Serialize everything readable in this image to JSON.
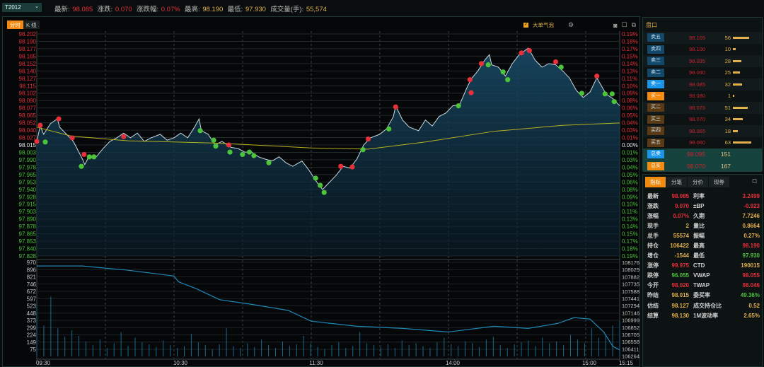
{
  "symbol": "T2012",
  "quote": [
    {
      "label": "最新:",
      "value": "98.085",
      "color": "red"
    },
    {
      "label": "涨跌:",
      "value": "0.070",
      "color": "red"
    },
    {
      "label": "涨跌幅:",
      "value": "0.07%",
      "color": "red"
    },
    {
      "label": "最高:",
      "value": "98.190",
      "color": "gold"
    },
    {
      "label": "最低:",
      "value": "97.930",
      "color": "gold"
    },
    {
      "label": "成交量(手):",
      "value": "55,574",
      "color": "gold"
    }
  ],
  "chart_tabs": [
    "分时",
    "K 线"
  ],
  "chart_options": {
    "bubble_label": "大单气泡",
    "bubble_checked": true
  },
  "colors": {
    "up": "#e8303a",
    "down": "#4cc43a",
    "neutral": "#e8e8e8",
    "avg": "#b8b020",
    "line": "#c8d8e0",
    "oi": "#1e8ab8",
    "vol": "#1a6a90"
  },
  "chart_data": {
    "type": "line",
    "price_ticks": [
      "98.202",
      "98.190",
      "98.177",
      "98.165",
      "98.152",
      "98.140",
      "98.127",
      "98.115",
      "98.102",
      "98.090",
      "98.077",
      "98.065",
      "98.052",
      "98.040",
      "98.027",
      "98.015",
      "98.003",
      "97.990",
      "97.978",
      "97.965",
      "97.953",
      "97.940",
      "97.928",
      "97.915",
      "97.903",
      "97.890",
      "97.878",
      "97.865",
      "97.853",
      "97.840",
      "97.828"
    ],
    "pct_ticks": [
      "0.19%",
      "0.18%",
      "0.17%",
      "0.15%",
      "0.14%",
      "0.13%",
      "0.11%",
      "0.10%",
      "0.09%",
      "0.08%",
      "0.06%",
      "0.05%",
      "0.04%",
      "0.03%",
      "0.01%",
      "0.00%",
      "0.01%",
      "0.03%",
      "0.04%",
      "0.05%",
      "0.06%",
      "0.08%",
      "0.09%",
      "0.10%",
      "0.11%",
      "0.13%",
      "0.14%",
      "0.15%",
      "0.17%",
      "0.18%",
      "0.19%"
    ],
    "prev_settle": 98.015,
    "ylim": [
      97.828,
      98.202
    ],
    "vol_ticks": [
      "970",
      "896",
      "821",
      "746",
      "672",
      "597",
      "523",
      "448",
      "373",
      "299",
      "224",
      "149",
      "75"
    ],
    "oi_ticks": [
      "108176",
      "108029",
      "107882",
      "107735",
      "107588",
      "107441",
      "107294",
      "107146",
      "106999",
      "106852",
      "106705",
      "106558",
      "106411",
      "106264"
    ],
    "vol_ylim": [
      0,
      1007
    ],
    "oi_ylim": [
      106264,
      108176
    ],
    "time_ticks": [
      "09:30",
      "10:30",
      "11:30",
      "14:00",
      "15:00",
      "15:15"
    ],
    "total_minutes": 255,
    "price": [
      [
        0,
        98.021
      ],
      [
        1.5,
        98.047
      ],
      [
        3,
        98.033
      ],
      [
        6,
        98.051
      ],
      [
        9,
        98.059
      ],
      [
        10,
        98.045
      ],
      [
        13,
        98.033
      ],
      [
        16,
        98.021
      ],
      [
        20,
        97.991
      ],
      [
        21,
        97.982
      ],
      [
        23,
        97.997
      ],
      [
        26,
        97.995
      ],
      [
        29,
        98.009
      ],
      [
        32,
        98.021
      ],
      [
        35,
        98.027
      ],
      [
        38,
        98.035
      ],
      [
        41,
        98.027
      ],
      [
        44,
        98.035
      ],
      [
        47,
        98.021
      ],
      [
        50,
        98.027
      ],
      [
        54,
        98.033
      ],
      [
        57,
        98.023
      ],
      [
        60,
        98.027
      ],
      [
        63,
        98.035
      ],
      [
        66,
        98.027
      ],
      [
        69,
        98.045
      ],
      [
        71,
        98.059
      ],
      [
        72,
        98.039
      ],
      [
        75,
        98.033
      ],
      [
        78,
        98.015
      ],
      [
        81,
        98.021
      ],
      [
        85,
        98.011
      ],
      [
        88,
        98.009
      ],
      [
        91,
        98.003
      ],
      [
        94,
        98.003
      ],
      [
        97,
        97.995
      ],
      [
        100,
        97.991
      ],
      [
        103,
        97.988
      ],
      [
        106,
        97.995
      ],
      [
        109,
        97.985
      ],
      [
        112,
        97.979
      ],
      [
        116,
        97.988
      ],
      [
        119,
        97.973
      ],
      [
        122,
        97.955
      ],
      [
        125,
        97.94
      ],
      [
        128,
        97.952
      ],
      [
        131,
        97.964
      ],
      [
        134,
        97.979
      ],
      [
        137,
        97.976
      ],
      [
        140,
        97.991
      ],
      [
        143,
        98.015
      ],
      [
        146,
        98.027
      ],
      [
        150,
        98.033
      ],
      [
        153,
        98.042
      ],
      [
        156,
        98.063
      ],
      [
        157,
        98.081
      ],
      [
        160,
        98.057
      ],
      [
        163,
        98.045
      ],
      [
        167,
        98.039
      ],
      [
        170,
        98.057
      ],
      [
        173,
        98.047
      ],
      [
        176,
        98.063
      ],
      [
        179,
        98.069
      ],
      [
        182,
        98.081
      ],
      [
        185,
        98.083
      ],
      [
        188,
        98.11
      ],
      [
        190,
        98.126
      ],
      [
        193,
        98.14
      ],
      [
        196,
        98.158
      ],
      [
        198,
        98.167
      ],
      [
        199,
        98.15
      ],
      [
        202,
        98.146
      ],
      [
        205,
        98.131
      ],
      [
        208,
        98.152
      ],
      [
        211,
        98.167
      ],
      [
        215,
        98.178
      ],
      [
        218,
        98.158
      ],
      [
        221,
        98.146
      ],
      [
        224,
        98.152
      ],
      [
        227,
        98.15
      ],
      [
        230,
        98.14
      ],
      [
        233,
        98.128
      ],
      [
        236,
        98.107
      ],
      [
        239,
        98.095
      ],
      [
        242,
        98.104
      ],
      [
        245,
        98.128
      ],
      [
        249,
        98.101
      ],
      [
        252,
        98.093
      ],
      [
        255,
        98.081
      ]
    ],
    "avg_price": [
      [
        0,
        98.045
      ],
      [
        15,
        98.03
      ],
      [
        40,
        98.022
      ],
      [
        80,
        98.018
      ],
      [
        120,
        98.01
      ],
      [
        145,
        98.008
      ],
      [
        170,
        98.02
      ],
      [
        200,
        98.038
      ],
      [
        230,
        98.048
      ],
      [
        255,
        98.052
      ]
    ],
    "bubbles_buy": [
      [
        0,
        98.021
      ],
      [
        1.5,
        98.048
      ],
      [
        9.6,
        98.059
      ],
      [
        15.5,
        98.027
      ],
      [
        20.7,
        97.999
      ],
      [
        38,
        98.029
      ],
      [
        84,
        98.015
      ],
      [
        133,
        97.979
      ],
      [
        138,
        97.978
      ],
      [
        145,
        98.025
      ],
      [
        157,
        98.079
      ],
      [
        189.5,
        98.125
      ],
      [
        190,
        98.103
      ],
      [
        194.5,
        98.152
      ],
      [
        212,
        98.17
      ],
      [
        215.5,
        98.174
      ],
      [
        227,
        98.155
      ],
      [
        245,
        98.131
      ]
    ],
    "bubbles_sell": [
      [
        3.7,
        98.02
      ],
      [
        19.5,
        97.979
      ],
      [
        23,
        97.995
      ],
      [
        25,
        97.995
      ],
      [
        71.5,
        98.039
      ],
      [
        77.4,
        98.023
      ],
      [
        78.3,
        98.013
      ],
      [
        84.5,
        98.003
      ],
      [
        90,
        97.999
      ],
      [
        93,
        98.003
      ],
      [
        95,
        97.997
      ],
      [
        101.5,
        97.985
      ],
      [
        122,
        97.959
      ],
      [
        124,
        97.947
      ],
      [
        125.7,
        97.935
      ],
      [
        142.7,
        98.007
      ],
      [
        154,
        98.042
      ],
      [
        184.5,
        98.081
      ],
      [
        197.5,
        98.15
      ],
      [
        204,
        98.138
      ],
      [
        206,
        98.125
      ],
      [
        229.4,
        98.146
      ],
      [
        238.4,
        98.102
      ],
      [
        248.6,
        98.101
      ],
      [
        251.7,
        98.101
      ],
      [
        252.6,
        98.088
      ]
    ],
    "open_interest": [
      [
        0,
        108075
      ],
      [
        20,
        108075
      ],
      [
        40,
        107989
      ],
      [
        60,
        107874
      ],
      [
        62,
        107759
      ],
      [
        70,
        107616
      ],
      [
        80,
        107400
      ],
      [
        95,
        107300
      ],
      [
        110,
        107185
      ],
      [
        120,
        106969
      ],
      [
        140,
        106868
      ],
      [
        160,
        106825
      ],
      [
        180,
        106753
      ],
      [
        200,
        106868
      ],
      [
        215,
        106825
      ],
      [
        228,
        106926
      ],
      [
        235,
        107041
      ],
      [
        242,
        107012
      ],
      [
        248,
        106753
      ],
      [
        252,
        106466
      ],
      [
        255,
        106394
      ]
    ],
    "volume": [
      560,
      330,
      640,
      300,
      210,
      280,
      220,
      160,
      120,
      180,
      90,
      140,
      260,
      110,
      200,
      150,
      130,
      100,
      170,
      120,
      90,
      110,
      240,
      150,
      120,
      80,
      130,
      300,
      110,
      90,
      140,
      100,
      180,
      120,
      90,
      160,
      110,
      130,
      220,
      140,
      100,
      80,
      120,
      150,
      90,
      110,
      260,
      140,
      120,
      100,
      130,
      90,
      170,
      120,
      140,
      110,
      90,
      150,
      200,
      130,
      110,
      160,
      140,
      100,
      180,
      210,
      120,
      90,
      130,
      150,
      170,
      110,
      200,
      140,
      160,
      120,
      230,
      180,
      140,
      300,
      200,
      240,
      330,
      380
    ]
  },
  "orderbook": {
    "title": "盘口",
    "asks": [
      {
        "label": "卖五",
        "price": "98.105",
        "qty": "56"
      },
      {
        "label": "卖四",
        "price": "98.100",
        "qty": "10"
      },
      {
        "label": "卖三",
        "price": "98.095",
        "qty": "28"
      },
      {
        "label": "卖二",
        "price": "98.090",
        "qty": "25"
      },
      {
        "label": "卖一",
        "price": "98.085",
        "qty": "32"
      }
    ],
    "bids": [
      {
        "label": "买一",
        "price": "98.080",
        "qty": "1"
      },
      {
        "label": "买二",
        "price": "98.075",
        "qty": "51"
      },
      {
        "label": "买三",
        "price": "98.070",
        "qty": "34"
      },
      {
        "label": "买四",
        "price": "98.065",
        "qty": "18"
      },
      {
        "label": "买五",
        "price": "98.060",
        "qty": "63"
      }
    ],
    "totals": [
      {
        "label": "总卖",
        "price": "98.095",
        "qty": "151"
      },
      {
        "label": "总买",
        "price": "98.070",
        "qty": "167"
      }
    ]
  },
  "stats": {
    "tabs": [
      "指标",
      "分笔",
      "分价",
      "现券"
    ],
    "rows": [
      [
        "最新",
        "98.085",
        "red",
        "利率",
        "3.2499",
        "red"
      ],
      [
        "涨跌",
        "0.070",
        "red",
        "±BP",
        "-0.923",
        "red"
      ],
      [
        "涨幅",
        "0.07%",
        "red",
        "久期",
        "7.7246",
        "gold"
      ],
      [
        "现手",
        "2",
        "gold",
        "量比",
        "0.8664",
        "gold"
      ],
      [
        "总手",
        "55574",
        "gold",
        "振幅",
        "0.27%",
        "gold"
      ],
      [
        "持仓",
        "106422",
        "gold",
        "最高",
        "98.190",
        "red"
      ],
      [
        "增仓",
        "-1544",
        "gold",
        "最低",
        "97.930",
        "green"
      ],
      [
        "涨停",
        "99.975",
        "red",
        "CTD",
        "190015",
        "gold"
      ],
      [
        "跌停",
        "96.055",
        "green",
        "VWAP",
        "98.055",
        "red"
      ],
      [
        "今开",
        "98.020",
        "red",
        "TWAP",
        "98.046",
        "red"
      ],
      [
        "昨结",
        "98.015",
        "gold",
        "委买率",
        "49.36%",
        "green"
      ],
      [
        "估结",
        "98.127",
        "gold",
        "成交持仓比",
        "0.52",
        "gold"
      ],
      [
        "结算",
        "98.130",
        "gold",
        "1M波动率",
        "2.65%",
        "gold"
      ]
    ]
  }
}
